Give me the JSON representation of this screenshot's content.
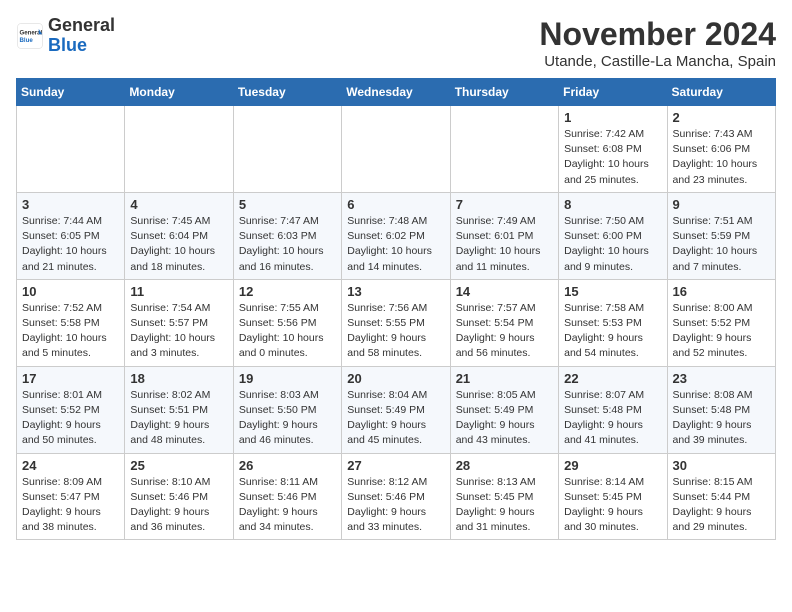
{
  "header": {
    "logo_general": "General",
    "logo_blue": "Blue",
    "month_title": "November 2024",
    "location": "Utande, Castille-La Mancha, Spain"
  },
  "days_of_week": [
    "Sunday",
    "Monday",
    "Tuesday",
    "Wednesday",
    "Thursday",
    "Friday",
    "Saturday"
  ],
  "weeks": [
    [
      {
        "day": "",
        "info": ""
      },
      {
        "day": "",
        "info": ""
      },
      {
        "day": "",
        "info": ""
      },
      {
        "day": "",
        "info": ""
      },
      {
        "day": "",
        "info": ""
      },
      {
        "day": "1",
        "info": "Sunrise: 7:42 AM\nSunset: 6:08 PM\nDaylight: 10 hours and 25 minutes."
      },
      {
        "day": "2",
        "info": "Sunrise: 7:43 AM\nSunset: 6:06 PM\nDaylight: 10 hours and 23 minutes."
      }
    ],
    [
      {
        "day": "3",
        "info": "Sunrise: 7:44 AM\nSunset: 6:05 PM\nDaylight: 10 hours and 21 minutes."
      },
      {
        "day": "4",
        "info": "Sunrise: 7:45 AM\nSunset: 6:04 PM\nDaylight: 10 hours and 18 minutes."
      },
      {
        "day": "5",
        "info": "Sunrise: 7:47 AM\nSunset: 6:03 PM\nDaylight: 10 hours and 16 minutes."
      },
      {
        "day": "6",
        "info": "Sunrise: 7:48 AM\nSunset: 6:02 PM\nDaylight: 10 hours and 14 minutes."
      },
      {
        "day": "7",
        "info": "Sunrise: 7:49 AM\nSunset: 6:01 PM\nDaylight: 10 hours and 11 minutes."
      },
      {
        "day": "8",
        "info": "Sunrise: 7:50 AM\nSunset: 6:00 PM\nDaylight: 10 hours and 9 minutes."
      },
      {
        "day": "9",
        "info": "Sunrise: 7:51 AM\nSunset: 5:59 PM\nDaylight: 10 hours and 7 minutes."
      }
    ],
    [
      {
        "day": "10",
        "info": "Sunrise: 7:52 AM\nSunset: 5:58 PM\nDaylight: 10 hours and 5 minutes."
      },
      {
        "day": "11",
        "info": "Sunrise: 7:54 AM\nSunset: 5:57 PM\nDaylight: 10 hours and 3 minutes."
      },
      {
        "day": "12",
        "info": "Sunrise: 7:55 AM\nSunset: 5:56 PM\nDaylight: 10 hours and 0 minutes."
      },
      {
        "day": "13",
        "info": "Sunrise: 7:56 AM\nSunset: 5:55 PM\nDaylight: 9 hours and 58 minutes."
      },
      {
        "day": "14",
        "info": "Sunrise: 7:57 AM\nSunset: 5:54 PM\nDaylight: 9 hours and 56 minutes."
      },
      {
        "day": "15",
        "info": "Sunrise: 7:58 AM\nSunset: 5:53 PM\nDaylight: 9 hours and 54 minutes."
      },
      {
        "day": "16",
        "info": "Sunrise: 8:00 AM\nSunset: 5:52 PM\nDaylight: 9 hours and 52 minutes."
      }
    ],
    [
      {
        "day": "17",
        "info": "Sunrise: 8:01 AM\nSunset: 5:52 PM\nDaylight: 9 hours and 50 minutes."
      },
      {
        "day": "18",
        "info": "Sunrise: 8:02 AM\nSunset: 5:51 PM\nDaylight: 9 hours and 48 minutes."
      },
      {
        "day": "19",
        "info": "Sunrise: 8:03 AM\nSunset: 5:50 PM\nDaylight: 9 hours and 46 minutes."
      },
      {
        "day": "20",
        "info": "Sunrise: 8:04 AM\nSunset: 5:49 PM\nDaylight: 9 hours and 45 minutes."
      },
      {
        "day": "21",
        "info": "Sunrise: 8:05 AM\nSunset: 5:49 PM\nDaylight: 9 hours and 43 minutes."
      },
      {
        "day": "22",
        "info": "Sunrise: 8:07 AM\nSunset: 5:48 PM\nDaylight: 9 hours and 41 minutes."
      },
      {
        "day": "23",
        "info": "Sunrise: 8:08 AM\nSunset: 5:48 PM\nDaylight: 9 hours and 39 minutes."
      }
    ],
    [
      {
        "day": "24",
        "info": "Sunrise: 8:09 AM\nSunset: 5:47 PM\nDaylight: 9 hours and 38 minutes."
      },
      {
        "day": "25",
        "info": "Sunrise: 8:10 AM\nSunset: 5:46 PM\nDaylight: 9 hours and 36 minutes."
      },
      {
        "day": "26",
        "info": "Sunrise: 8:11 AM\nSunset: 5:46 PM\nDaylight: 9 hours and 34 minutes."
      },
      {
        "day": "27",
        "info": "Sunrise: 8:12 AM\nSunset: 5:46 PM\nDaylight: 9 hours and 33 minutes."
      },
      {
        "day": "28",
        "info": "Sunrise: 8:13 AM\nSunset: 5:45 PM\nDaylight: 9 hours and 31 minutes."
      },
      {
        "day": "29",
        "info": "Sunrise: 8:14 AM\nSunset: 5:45 PM\nDaylight: 9 hours and 30 minutes."
      },
      {
        "day": "30",
        "info": "Sunrise: 8:15 AM\nSunset: 5:44 PM\nDaylight: 9 hours and 29 minutes."
      }
    ]
  ]
}
